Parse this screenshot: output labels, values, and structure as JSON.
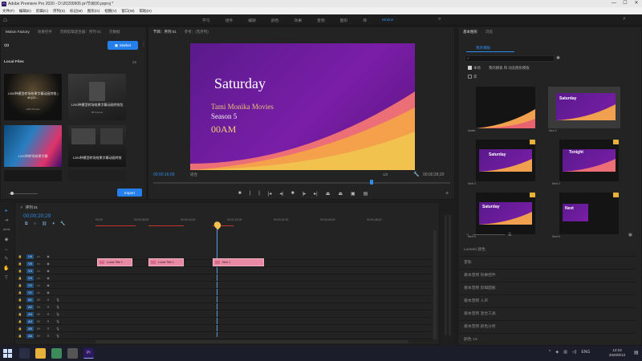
{
  "window": {
    "title": "Adobe Premiere Pro 2020 - D:\\20200905 pr\\节目00.prproj *",
    "app_icon_label": "Pr"
  },
  "window_controls": [
    "—",
    "☐",
    "✕"
  ],
  "menu": [
    "文件(F)",
    "编辑(E)",
    "剪辑(C)",
    "序列(S)",
    "标记(M)",
    "图形(G)",
    "视图(V)",
    "窗口(W)",
    "帮助(H)"
  ],
  "workspace_tabs": [
    {
      "label": "学习",
      "active": false
    },
    {
      "label": "组件",
      "active": false
    },
    {
      "label": "编辑",
      "active": false
    },
    {
      "label": "颜色",
      "active": false
    },
    {
      "label": "效果",
      "active": false
    },
    {
      "label": "音频",
      "active": false
    },
    {
      "label": "图形",
      "active": false
    },
    {
      "label": "库",
      "active": false
    },
    {
      "label": "Motion",
      "active": true
    }
  ],
  "left_panel": {
    "tabs": [
      "Motion Factory",
      "效果控件",
      "音频剪辑混合器：序列 01",
      "元数据"
    ],
    "logo": "∞",
    "market_button": "Market",
    "section_title": "Local Files",
    "item_count": "26",
    "import_button": "Import",
    "thumbs": [
      {
        "label": "1200种模型转场效果字幕动画特效 | 4K(20...",
        "sub": "1200 Presets"
      },
      {
        "label": "1200种模型转场效果字幕动画特效包",
        "sub": "58 Presets"
      },
      {
        "label": "1200种转场效果字幕",
        "sub": ""
      },
      {
        "label": "1200种模型转场效果字幕动画特效",
        "sub": ""
      }
    ]
  },
  "program_monitor": {
    "tabs": [
      "节目：序列 01",
      "参考：(无序列)"
    ],
    "text_line1": "Saturday",
    "text_line2": "Tami Monika Movies",
    "text_line3": "Season 5",
    "text_line4": "00AM",
    "timecode_left": "00;00;16;09",
    "fit_label": "适合",
    "quality": "1/2",
    "timecode_right": "00;00;28;20"
  },
  "timeline": {
    "tab": "序列 01",
    "timecode": "00;00;20;29",
    "ruler": [
      "00;00",
      "00;00;08;00",
      "00;00;16;00",
      "00;00;24;00",
      "00;00;32;00",
      "00;00;40;00",
      "00;00;48;00"
    ],
    "tracks": [
      {
        "name": "V6",
        "y": 0
      },
      {
        "name": "V5",
        "y": 0
      },
      {
        "name": "V4",
        "y": 0
      },
      {
        "name": "V3",
        "y": 0
      },
      {
        "name": "V2",
        "y": 0
      },
      {
        "name": "V1",
        "y": 0
      },
      {
        "name": "A1",
        "y": 0
      },
      {
        "name": "A2",
        "y": 0
      },
      {
        "name": "A3",
        "y": 0
      },
      {
        "name": "A4",
        "y": 0
      },
      {
        "name": "A5",
        "y": 0
      },
      {
        "name": "A6",
        "y": 0
      },
      {
        "name": "A7",
        "y": 0
      },
      {
        "name": "A8",
        "y": 0
      }
    ],
    "clips": [
      "Loose Title 1",
      "Loose Title 1",
      "Next 1"
    ]
  },
  "right_panel": {
    "tabs": [
      "基本图形",
      "浏览",
      "编辑"
    ],
    "active_tab": "我的模板",
    "search_placeholder": "",
    "filter_checkbox": "本地",
    "filter_select": "我的模板 和 动态图形模板",
    "checkbox2": "库",
    "cards": [
      {
        "name": "Mathe",
        "title": "",
        "kind": "dark"
      },
      {
        "name": "Next 2",
        "title": "Saturday",
        "kind": "purple"
      },
      {
        "name": "Next 3",
        "title": "Saturday",
        "kind": "purple"
      },
      {
        "name": "Next 4",
        "title": "Tonight",
        "kind": "purple"
      },
      {
        "name": "Next 5",
        "title": "Saturday",
        "kind": "purple"
      },
      {
        "name": "Next 6",
        "title": "Next",
        "kind": "purple"
      }
    ],
    "sections": [
      "Lumetri 颜色",
      "音轨",
      "基本音频 效果控件",
      "基本音频 剪辑面板",
      "基本音频 人声",
      "基本音频 混合工具",
      "基本音频 颜色分析",
      "颜色 1S"
    ]
  },
  "taskbar": {
    "clock_time": "12:23",
    "clock_date": "2020/9/13",
    "lang": "ENG"
  },
  "colors": {
    "accent": "#2680eb",
    "clip": "#e98aa5",
    "purple": "#6c1a9c"
  }
}
